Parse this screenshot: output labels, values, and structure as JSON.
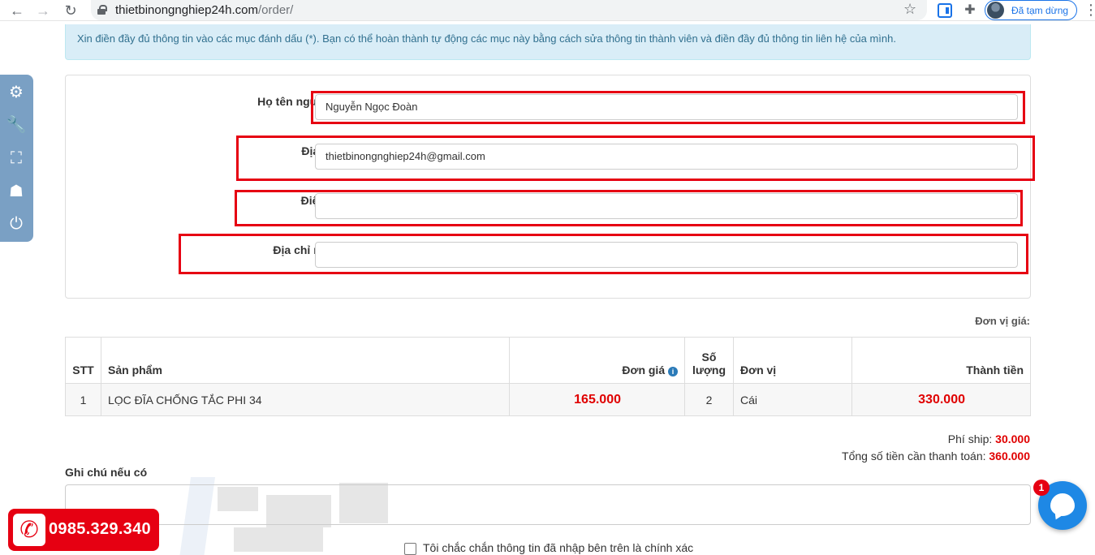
{
  "browser": {
    "url_domain": "thietbinongnghiep24h.com",
    "url_path": "/order/",
    "profile_status": "Đã tạm dừng"
  },
  "alert": {
    "text": "Xin điền đầy đủ thông tin vào các mục đánh dấu (*). Bạn có thể hoàn thành tự động các mục này bằng cách sửa thông tin thành viên và điền đầy đủ thông tin liên hệ của mình."
  },
  "form": {
    "required_mark": "(*)",
    "name_label": "Họ tên người mua",
    "name_value": "Nguyễn Ngọc Đoàn",
    "email_label": "Địa chỉ email",
    "email_value": "thietbinongnghiep24h@gmail.com",
    "phone_label": "Điện thoại",
    "phone_value": "",
    "address_label": "Địa chỉ nhận hàng",
    "address_value": ""
  },
  "unit_note": "Đơn vị giá:",
  "table": {
    "headers": {
      "stt": "STT",
      "product": "Sản phẩm",
      "price": "Đơn giá",
      "qty_line1": "Số",
      "qty_line2": "lượng",
      "unit": "Đơn vị",
      "total": "Thành tiền"
    },
    "rows": [
      {
        "stt": "1",
        "product": "LỌC ĐĨA CHỐNG TẮC PHI 34",
        "price": "165.000",
        "qty": "2",
        "unit": "Cái",
        "total": "330.000"
      }
    ]
  },
  "summary": {
    "ship_label": "Phí ship:",
    "ship_value": "30.000",
    "grand_label": "Tổng số tiền cần thanh toán:",
    "grand_value": "360.000"
  },
  "note": {
    "label": "Ghi chú nếu có",
    "value": ""
  },
  "confirm": {
    "label": "Tôi chắc chắn thông tin đã nhập bên trên là chính xác"
  },
  "hotline": {
    "number": "0985.329.340"
  },
  "messenger": {
    "badge": "1"
  },
  "colors": {
    "accent_red": "#e00000",
    "highlight_box": "#e60012",
    "alert_bg": "#d9edf7",
    "messenger_blue": "#1e88e5"
  }
}
